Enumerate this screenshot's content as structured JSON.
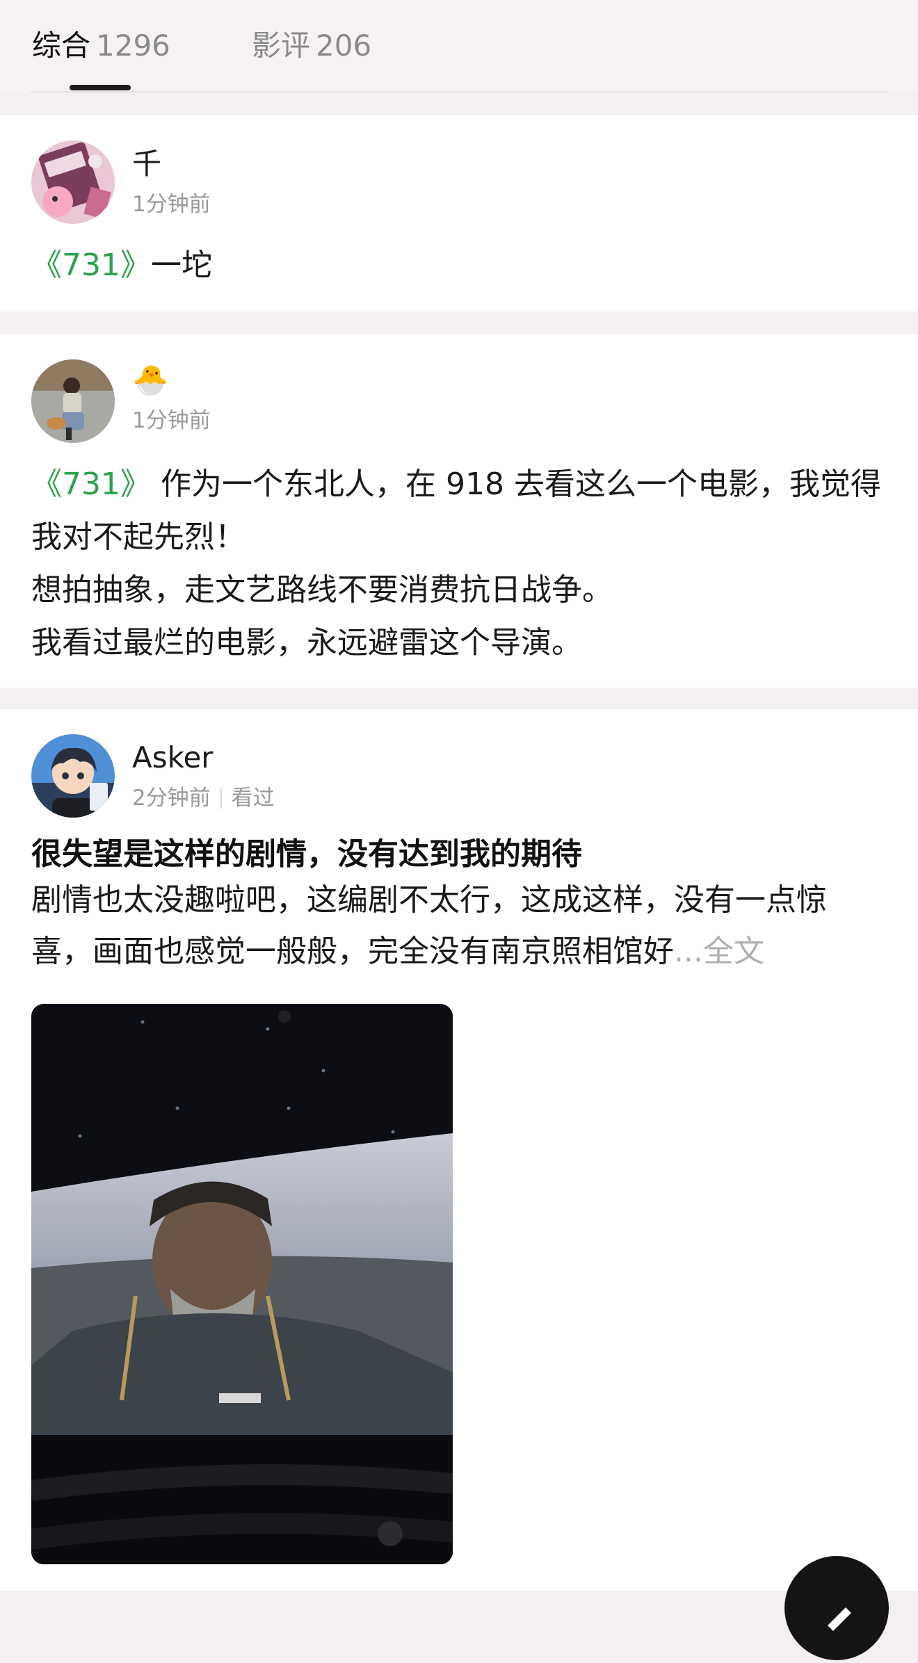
{
  "tabs": [
    {
      "label": "综合",
      "count": "1296"
    },
    {
      "label": "影评",
      "count": "206"
    }
  ],
  "posts": [
    {
      "user": "千",
      "time": "1分钟前",
      "movie": "《731》",
      "text": "一坨"
    },
    {
      "user": "🐣",
      "time": "1分钟前",
      "movie": "《731》",
      "line1": "作为一个东北人，在 918 去看这么一个电影，我觉得我对不起先烈！",
      "line2": "想拍抽象，走文艺路线不要消费抗日战争。",
      "line3": "我看过最烂的电影，永远避雷这个导演。"
    },
    {
      "user": "Asker",
      "time": "2分钟前",
      "status": "看过",
      "title": "很失望是这样的剧情，没有达到我的期待",
      "text": "剧情也太没趣啦吧，这编剧不太行，这成这样，没有一点惊喜，画面也感觉一般般，完全没有南京照相馆好",
      "ellipsis": "...",
      "more": "全文"
    }
  ],
  "colors": {
    "accent": "#2aa34a",
    "muted": "#9a9a9a"
  }
}
